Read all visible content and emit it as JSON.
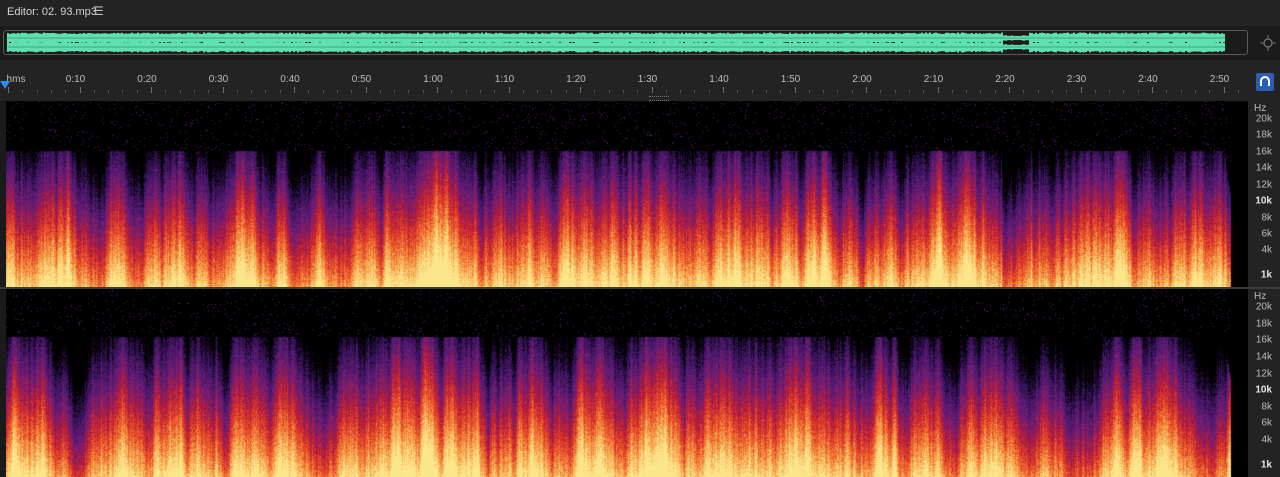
{
  "editor": {
    "title": "Editor: 02. 93.mp3",
    "menu_icon": "hamburger-menu-icon"
  },
  "overview": {
    "waveform_color": "#5ee0b0"
  },
  "ruler": {
    "labels": [
      "hms",
      "0:10",
      "0:20",
      "0:30",
      "0:40",
      "0:50",
      "1:00",
      "1:10",
      "1:20",
      "1:30",
      "1:40",
      "1:50",
      "2:00",
      "2:10",
      "2:20",
      "2:30",
      "2:40",
      "2:50"
    ],
    "seconds": [
      0,
      10,
      20,
      30,
      40,
      50,
      60,
      70,
      80,
      90,
      100,
      110,
      120,
      130,
      140,
      150,
      160,
      170
    ],
    "duration_seconds": 172,
    "playhead_color": "#2d8ceb"
  },
  "channels": [
    {
      "hz_unit": "Hz",
      "hz_labels": [
        "20k",
        "18k",
        "16k",
        "14k",
        "12k",
        "10k",
        "8k",
        "6k",
        "4k",
        "1k"
      ]
    },
    {
      "hz_unit": "Hz",
      "hz_labels": [
        "20k",
        "18k",
        "16k",
        "14k",
        "12k",
        "10k",
        "8k",
        "6k",
        "4k",
        "1k"
      ]
    }
  ],
  "spectral_colors": [
    "#fce08a",
    "#f6a34a",
    "#e84a25",
    "#b51a3a",
    "#6a1e7a",
    "#3a1460",
    "#000000"
  ]
}
